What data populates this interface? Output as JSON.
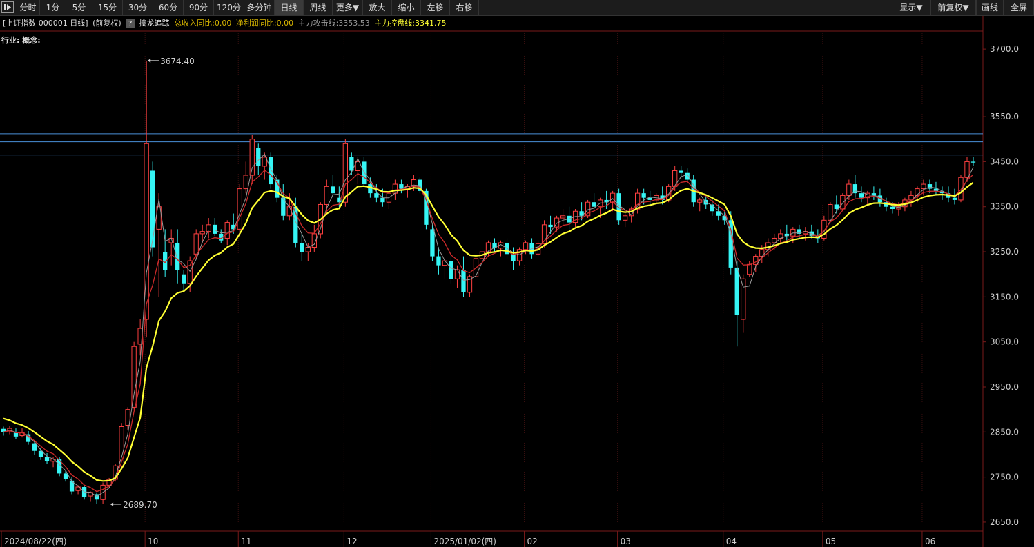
{
  "toolbar": {
    "play_icon": "play-icon",
    "left_buttons": [
      "分时",
      "1分",
      "5分",
      "15分",
      "30分",
      "60分",
      "90分",
      "120分",
      "多分钟",
      "日线",
      "周线",
      "更多▼",
      "放大",
      "缩小",
      "左移",
      "右移"
    ],
    "active": "日线",
    "right_buttons": [
      "显示▼",
      "前复权▼",
      "画线",
      "全屏"
    ]
  },
  "info": {
    "title": "[上证指数 000001 日线]",
    "adjust": "(前复权)",
    "help_icon": "?",
    "tracker": "擒龙追踪",
    "revenue_yoy": "总收入同比:0.00",
    "profit_yoy": "净利润同比:0.00",
    "attack_line": "主力攻击线:3353.53",
    "control_line": "主力控盘线:3341.75",
    "colors": {
      "revenue": "#d8b600",
      "profit": "#d8b600",
      "attack": "#9a9a9a",
      "control": "#ffff33"
    }
  },
  "industry_label": "行业: 概念:",
  "chart_data": {
    "type": "candlestick",
    "ylim": [
      2630,
      3740
    ],
    "y_ticks": [
      3700,
      3550,
      3450,
      3350,
      3250,
      3150,
      3050,
      2950,
      2850,
      2750,
      2650
    ],
    "y_tick_labels": [
      "3700.0",
      "3550.0",
      "3450.0",
      "3350.0",
      "3250.0",
      "3150.0",
      "3050.0",
      "2950.0",
      "2850.0",
      "2750.0",
      "2650.0"
    ],
    "x_labels": [
      "2024/08/22(四)",
      "10",
      "11",
      "12",
      "2025/01/02(四)",
      "02",
      "03",
      "04",
      "05",
      "06"
    ],
    "x_label_index": [
      0,
      23,
      38,
      55,
      69,
      84,
      99,
      116,
      132,
      148
    ],
    "annotations": [
      {
        "text": "3674.40",
        "index": 23,
        "value": 3674.4
      },
      {
        "text": "2689.70",
        "index": 17,
        "value": 2689.7
      }
    ],
    "horizontal_lines": [
      3512,
      3494,
      3465
    ],
    "colors": {
      "up": "#ff4040",
      "down": "#35f5f5",
      "ma_fast": "#cc2a2a",
      "ma_slow": "#ffff33",
      "ma_thin": "#9a9a9a",
      "hline": "#4a90d9"
    },
    "candles": [
      [
        2857,
        2862,
        2842,
        2850
      ],
      [
        2852,
        2864,
        2845,
        2858
      ],
      [
        2850,
        2858,
        2835,
        2840
      ],
      [
        2842,
        2858,
        2838,
        2848
      ],
      [
        2845,
        2852,
        2822,
        2828
      ],
      [
        2825,
        2832,
        2800,
        2808
      ],
      [
        2808,
        2815,
        2788,
        2795
      ],
      [
        2795,
        2803,
        2780,
        2785
      ],
      [
        2785,
        2795,
        2772,
        2790
      ],
      [
        2790,
        2795,
        2752,
        2758
      ],
      [
        2758,
        2765,
        2740,
        2745
      ],
      [
        2742,
        2750,
        2712,
        2718
      ],
      [
        2720,
        2732,
        2712,
        2728
      ],
      [
        2728,
        2732,
        2700,
        2705
      ],
      [
        2708,
        2718,
        2695,
        2716
      ],
      [
        2712,
        2716,
        2690,
        2700
      ],
      [
        2700,
        2738,
        2690,
        2732
      ],
      [
        2732,
        2748,
        2725,
        2745
      ],
      [
        2745,
        2780,
        2740,
        2775
      ],
      [
        2775,
        2870,
        2770,
        2862
      ],
      [
        2865,
        2905,
        2855,
        2900
      ],
      [
        2905,
        3050,
        2900,
        3040
      ],
      [
        3045,
        3100,
        3020,
        3080
      ],
      [
        3100,
        3674,
        3060,
        3490
      ],
      [
        3430,
        3450,
        3240,
        3260
      ],
      [
        3300,
        3380,
        3150,
        3350
      ],
      [
        3250,
        3300,
        3195,
        3210
      ],
      [
        3270,
        3300,
        3220,
        3280
      ],
      [
        3270,
        3300,
        3180,
        3210
      ],
      [
        3200,
        3210,
        3160,
        3180
      ],
      [
        3180,
        3240,
        3160,
        3230
      ],
      [
        3245,
        3300,
        3235,
        3290
      ],
      [
        3290,
        3310,
        3270,
        3295
      ],
      [
        3295,
        3325,
        3280,
        3310
      ],
      [
        3310,
        3325,
        3285,
        3290
      ],
      [
        3290,
        3300,
        3270,
        3275
      ],
      [
        3280,
        3320,
        3265,
        3315
      ],
      [
        3310,
        3335,
        3290,
        3300
      ],
      [
        3300,
        3400,
        3290,
        3390
      ],
      [
        3390,
        3450,
        3380,
        3420
      ],
      [
        3420,
        3510,
        3400,
        3500
      ],
      [
        3480,
        3490,
        3420,
        3440
      ],
      [
        3440,
        3470,
        3410,
        3460
      ],
      [
        3460,
        3470,
        3390,
        3400
      ],
      [
        3410,
        3420,
        3360,
        3370
      ],
      [
        3370,
        3400,
        3320,
        3330
      ],
      [
        3330,
        3380,
        3320,
        3350
      ],
      [
        3350,
        3370,
        3260,
        3270
      ],
      [
        3270,
        3290,
        3230,
        3250
      ],
      [
        3250,
        3270,
        3230,
        3260
      ],
      [
        3260,
        3310,
        3250,
        3290
      ],
      [
        3290,
        3360,
        3280,
        3355
      ],
      [
        3355,
        3410,
        3340,
        3395
      ],
      [
        3395,
        3420,
        3370,
        3380
      ],
      [
        3370,
        3395,
        3350,
        3360
      ],
      [
        3360,
        3500,
        3350,
        3490
      ],
      [
        3460,
        3470,
        3420,
        3430
      ],
      [
        3430,
        3460,
        3400,
        3450
      ],
      [
        3450,
        3460,
        3395,
        3400
      ],
      [
        3400,
        3415,
        3370,
        3380
      ],
      [
        3380,
        3400,
        3360,
        3370
      ],
      [
        3370,
        3390,
        3350,
        3360
      ],
      [
        3360,
        3385,
        3345,
        3380
      ],
      [
        3380,
        3410,
        3365,
        3400
      ],
      [
        3400,
        3410,
        3380,
        3390
      ],
      [
        3390,
        3400,
        3370,
        3395
      ],
      [
        3395,
        3420,
        3385,
        3410
      ],
      [
        3410,
        3415,
        3380,
        3385
      ],
      [
        3385,
        3390,
        3300,
        3310
      ],
      [
        3300,
        3310,
        3230,
        3240
      ],
      [
        3240,
        3260,
        3200,
        3220
      ],
      [
        3220,
        3240,
        3190,
        3230
      ],
      [
        3230,
        3250,
        3180,
        3190
      ],
      [
        3190,
        3220,
        3170,
        3210
      ],
      [
        3210,
        3240,
        3150,
        3160
      ],
      [
        3160,
        3200,
        3150,
        3195
      ],
      [
        3195,
        3240,
        3185,
        3235
      ],
      [
        3235,
        3260,
        3220,
        3250
      ],
      [
        3250,
        3275,
        3240,
        3270
      ],
      [
        3270,
        3280,
        3250,
        3258
      ],
      [
        3258,
        3275,
        3240,
        3270
      ],
      [
        3270,
        3280,
        3235,
        3245
      ],
      [
        3245,
        3260,
        3210,
        3230
      ],
      [
        3230,
        3260,
        3220,
        3255
      ],
      [
        3255,
        3275,
        3245,
        3270
      ],
      [
        3270,
        3280,
        3235,
        3245
      ],
      [
        3245,
        3275,
        3240,
        3268
      ],
      [
        3268,
        3320,
        3260,
        3310
      ],
      [
        3310,
        3330,
        3290,
        3305
      ],
      [
        3305,
        3330,
        3295,
        3325
      ],
      [
        3325,
        3345,
        3310,
        3330
      ],
      [
        3330,
        3350,
        3300,
        3315
      ],
      [
        3315,
        3345,
        3305,
        3340
      ],
      [
        3340,
        3360,
        3320,
        3330
      ],
      [
        3330,
        3365,
        3325,
        3360
      ],
      [
        3360,
        3380,
        3340,
        3350
      ],
      [
        3350,
        3370,
        3325,
        3365
      ],
      [
        3365,
        3385,
        3345,
        3360
      ],
      [
        3360,
        3385,
        3340,
        3380
      ],
      [
        3380,
        3390,
        3310,
        3320
      ],
      [
        3320,
        3340,
        3305,
        3330
      ],
      [
        3330,
        3350,
        3315,
        3345
      ],
      [
        3345,
        3390,
        3335,
        3380
      ],
      [
        3380,
        3390,
        3355,
        3370
      ],
      [
        3370,
        3385,
        3350,
        3365
      ],
      [
        3365,
        3380,
        3355,
        3375
      ],
      [
        3375,
        3395,
        3355,
        3365
      ],
      [
        3365,
        3400,
        3360,
        3395
      ],
      [
        3395,
        3440,
        3385,
        3430
      ],
      [
        3430,
        3440,
        3415,
        3425
      ],
      [
        3425,
        3435,
        3405,
        3410
      ],
      [
        3410,
        3420,
        3350,
        3360
      ],
      [
        3360,
        3370,
        3340,
        3365
      ],
      [
        3365,
        3375,
        3345,
        3355
      ],
      [
        3355,
        3370,
        3330,
        3340
      ],
      [
        3340,
        3355,
        3320,
        3330
      ],
      [
        3330,
        3340,
        3310,
        3320
      ],
      [
        3320,
        3340,
        3200,
        3215
      ],
      [
        3215,
        3230,
        3040,
        3110
      ],
      [
        3100,
        3200,
        3070,
        3190
      ],
      [
        3200,
        3230,
        3195,
        3222
      ],
      [
        3222,
        3245,
        3205,
        3240
      ],
      [
        3240,
        3265,
        3225,
        3255
      ],
      [
        3255,
        3280,
        3240,
        3270
      ],
      [
        3270,
        3290,
        3255,
        3280
      ],
      [
        3280,
        3300,
        3270,
        3290
      ],
      [
        3290,
        3310,
        3275,
        3285
      ],
      [
        3285,
        3305,
        3270,
        3300
      ],
      [
        3300,
        3310,
        3280,
        3290
      ],
      [
        3290,
        3305,
        3275,
        3295
      ],
      [
        3295,
        3310,
        3280,
        3285
      ],
      [
        3285,
        3300,
        3270,
        3280
      ],
      [
        3280,
        3330,
        3275,
        3320
      ],
      [
        3320,
        3360,
        3315,
        3355
      ],
      [
        3355,
        3375,
        3335,
        3345
      ],
      [
        3345,
        3380,
        3340,
        3375
      ],
      [
        3375,
        3410,
        3365,
        3400
      ],
      [
        3400,
        3420,
        3370,
        3380
      ],
      [
        3380,
        3395,
        3360,
        3370
      ],
      [
        3370,
        3385,
        3355,
        3380
      ],
      [
        3380,
        3395,
        3365,
        3375
      ],
      [
        3375,
        3390,
        3350,
        3360
      ],
      [
        3360,
        3370,
        3340,
        3350
      ],
      [
        3350,
        3360,
        3335,
        3345
      ],
      [
        3345,
        3360,
        3330,
        3350
      ],
      [
        3350,
        3370,
        3340,
        3365
      ],
      [
        3365,
        3385,
        3350,
        3375
      ],
      [
        3375,
        3395,
        3360,
        3390
      ],
      [
        3390,
        3410,
        3375,
        3400
      ],
      [
        3400,
        3410,
        3380,
        3390
      ],
      [
        3390,
        3405,
        3375,
        3385
      ],
      [
        3385,
        3395,
        3365,
        3380
      ],
      [
        3380,
        3395,
        3360,
        3370
      ],
      [
        3370,
        3390,
        3355,
        3365
      ],
      [
        3365,
        3420,
        3360,
        3415
      ],
      [
        3415,
        3460,
        3405,
        3450
      ],
      [
        3450,
        3460,
        3440,
        3448
      ]
    ]
  }
}
